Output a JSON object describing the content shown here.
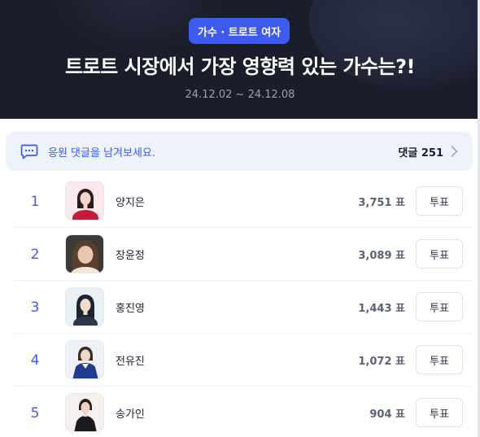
{
  "header": {
    "badge": "가수 · 트로트 여자",
    "title": "트로트 시장에서 가장 영향력 있는 가수는?!",
    "period": "24.12.02 ~ 24.12.08"
  },
  "comments": {
    "prompt": "응원 댓글을 남겨보세요.",
    "count_label": "댓글 251",
    "icon": "comment-icon",
    "chevron": "›"
  },
  "rankings": [
    {
      "rank": "1",
      "name": "양지은",
      "votes": "3,751 표",
      "vote_label": "투표"
    },
    {
      "rank": "2",
      "name": "장윤정",
      "votes": "3,089 표",
      "vote_label": "투표"
    },
    {
      "rank": "3",
      "name": "홍진영",
      "votes": "1,443 표",
      "vote_label": "투표"
    },
    {
      "rank": "4",
      "name": "전유진",
      "votes": "1,072 표",
      "vote_label": "투표"
    },
    {
      "rank": "5",
      "name": "송가인",
      "votes": "904 표",
      "vote_label": "투표"
    }
  ],
  "colors": {
    "accent": "#3d5af1",
    "header_bg": "#1a1d2a",
    "comment_bg": "#eef2fb"
  }
}
